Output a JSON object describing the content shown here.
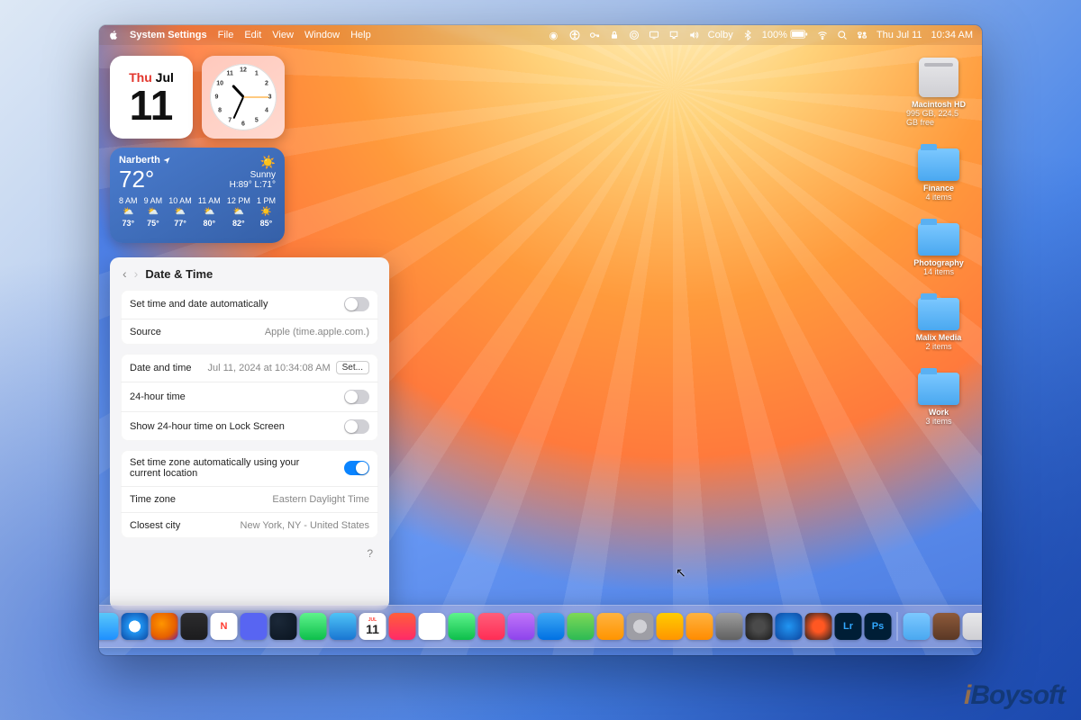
{
  "menubar": {
    "app": "System Settings",
    "items": [
      "File",
      "Edit",
      "View",
      "Window",
      "Help"
    ],
    "user": "Colby",
    "battery": "100%",
    "date": "Thu Jul 11",
    "time": "10:34 AM"
  },
  "cal_widget": {
    "dow": "Thu",
    "mon": "Jul",
    "day": "11"
  },
  "clock_widget": {
    "hour": 10,
    "minute": 34
  },
  "weather": {
    "location": "Narberth",
    "temp": "72°",
    "cond": "Sunny",
    "hilo": "H:89° L:71°",
    "hours": [
      {
        "t": "8 AM",
        "i": "⛅",
        "d": "73°"
      },
      {
        "t": "9 AM",
        "i": "⛅",
        "d": "75°"
      },
      {
        "t": "10 AM",
        "i": "⛅",
        "d": "77°"
      },
      {
        "t": "11 AM",
        "i": "⛅",
        "d": "80°"
      },
      {
        "t": "12 PM",
        "i": "⛅",
        "d": "82°"
      },
      {
        "t": "1 PM",
        "i": "☀️",
        "d": "85°"
      }
    ]
  },
  "settings": {
    "title": "Date & Time",
    "auto_dt_label": "Set time and date automatically",
    "auto_dt_on": false,
    "source_label": "Source",
    "source_val": "Apple (time.apple.com.)",
    "dt_label": "Date and time",
    "dt_val": "Jul 11, 2024 at 10:34:08 AM",
    "set_btn": "Set...",
    "h24_label": "24-hour time",
    "h24_on": false,
    "lock24_label": "Show 24-hour time on Lock Screen",
    "lock24_on": false,
    "auto_tz_label": "Set time zone automatically using your current location",
    "auto_tz_on": true,
    "tz_label": "Time zone",
    "tz_val": "Eastern Daylight Time",
    "city_label": "Closest city",
    "city_val": "New York, NY - United States",
    "help": "?"
  },
  "desktop": {
    "hd": {
      "title": "Macintosh HD",
      "sub": "995 GB, 224.5 GB free"
    },
    "folders": [
      {
        "title": "Finance",
        "sub": "4 items"
      },
      {
        "title": "Photography",
        "sub": "14 items"
      },
      {
        "title": "Malix Media",
        "sub": "2 items"
      },
      {
        "title": "Work",
        "sub": "3 items"
      }
    ]
  },
  "dock": [
    {
      "name": "finder",
      "bg": "linear-gradient(#5ac8fa,#1e90ff)"
    },
    {
      "name": "safari",
      "bg": "radial-gradient(circle,#fff 30%,#2196f3 31%,#0d47a1)"
    },
    {
      "name": "firefox",
      "bg": "radial-gradient(circle at 40% 40%,#ff9500,#e66000 60%,#731d9e)"
    },
    {
      "name": "app-dark",
      "bg": "linear-gradient(#2c2c2e,#1c1c1e)"
    },
    {
      "name": "news",
      "bg": "linear-gradient(#fff,#fff)",
      "fg": "N",
      "fgc": "#ff3b30"
    },
    {
      "name": "discord",
      "bg": "#5865f2"
    },
    {
      "name": "steam",
      "bg": "radial-gradient(circle at 30% 30%,#1b2838,#0a1420)"
    },
    {
      "name": "messages",
      "bg": "linear-gradient(#5ef38c,#0dbf4b)"
    },
    {
      "name": "mail",
      "bg": "linear-gradient(#4fc3f7,#1976d2)"
    },
    {
      "name": "calendar",
      "bg": "#fff",
      "badge": "11",
      "badgetop": "JUL"
    },
    {
      "name": "app-red",
      "bg": "linear-gradient(#ff5e3a,#ff2a68)"
    },
    {
      "name": "photos",
      "bg": "#fff"
    },
    {
      "name": "facetime",
      "bg": "linear-gradient(#5ef38c,#0dbf4b)"
    },
    {
      "name": "music",
      "bg": "linear-gradient(#ff5e7a,#ff2d55)"
    },
    {
      "name": "podcasts",
      "bg": "linear-gradient(#c074f9,#8e44ec)"
    },
    {
      "name": "keynote",
      "bg": "linear-gradient(#3fa9f5,#0071e3)"
    },
    {
      "name": "numbers",
      "bg": "linear-gradient(#7ed957,#2dbb54)"
    },
    {
      "name": "pages",
      "bg": "linear-gradient(#ffb340,#ff9500)"
    },
    {
      "name": "settings",
      "bg": "radial-gradient(circle,#d0d0d5 35%,#9e9ea5 36%)"
    },
    {
      "name": "audacity",
      "bg": "linear-gradient(#ffcc00,#ff9500)"
    },
    {
      "name": "garageband",
      "bg": "linear-gradient(#ffb340,#ff8c00)"
    },
    {
      "name": "app-misc1",
      "bg": "linear-gradient(#9e9e9e,#616161)"
    },
    {
      "name": "finalcut",
      "bg": "radial-gradient(circle,#4a4a4a 30%,#1a1a1a)"
    },
    {
      "name": "app-misc2",
      "bg": "radial-gradient(circle,#2196f3,#0d47a1)"
    },
    {
      "name": "davinci",
      "bg": "radial-gradient(circle,#ff5722 30%,#212121)"
    },
    {
      "name": "lightroom",
      "bg": "#001e36",
      "fg": "Lr",
      "fgc": "#31a8ff"
    },
    {
      "name": "photoshop",
      "bg": "#001e36",
      "fg": "Ps",
      "fgc": "#31a8ff"
    }
  ],
  "dock_right": [
    {
      "name": "downloads",
      "bg": "linear-gradient(#7cc8ff,#4aa8f0)"
    },
    {
      "name": "recent",
      "bg": "linear-gradient(#8e5a3a,#5a3825)"
    },
    {
      "name": "trash",
      "bg": "linear-gradient(#e8e8ea,#cfcfd4)"
    }
  ],
  "watermark": "iBoysoft"
}
